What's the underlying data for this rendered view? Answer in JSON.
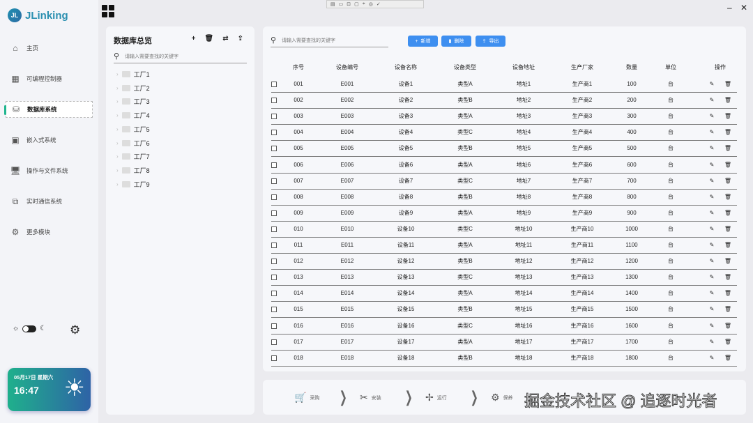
{
  "app": {
    "logo_badge": "JL",
    "title": "JLinking"
  },
  "sidebar": {
    "items": [
      {
        "label": "主页",
        "icon": "home-icon",
        "glyph": "⌂"
      },
      {
        "label": "可编程控制器",
        "icon": "chip-icon",
        "glyph": "▦"
      },
      {
        "label": "数据库系统",
        "icon": "database-icon",
        "glyph": "⛁",
        "active": true
      },
      {
        "label": "嵌入式系统",
        "icon": "cpu-icon",
        "glyph": "▣"
      },
      {
        "label": "操作与文件系统",
        "icon": "os-monitor-icon",
        "glyph": "🖥"
      },
      {
        "label": "实时通信系统",
        "icon": "communication-icon",
        "glyph": "⧉"
      },
      {
        "label": "更多模块",
        "icon": "gear-icon",
        "glyph": "⚙"
      }
    ]
  },
  "weather": {
    "date": "05月17日  星期六",
    "time": "16:47"
  },
  "tree": {
    "title": "数据库总览",
    "search_placeholder": "请输入需要查找的关键字",
    "items": [
      "工厂1",
      "工厂2",
      "工厂3",
      "工厂4",
      "工厂5",
      "工厂6",
      "工厂7",
      "工厂8",
      "工厂9"
    ]
  },
  "table": {
    "search_placeholder": "请输入需要查找的关键字",
    "buttons": {
      "add": "新增",
      "delete": "删除",
      "export": "导出"
    },
    "headers": [
      "序号",
      "设备编号",
      "设备名称",
      "设备类型",
      "设备地址",
      "生产厂家",
      "数量",
      "单位",
      "操作"
    ],
    "types": [
      "A",
      "B",
      "A",
      "C",
      "B",
      "A",
      "C",
      "B",
      "A",
      "C",
      "A",
      "B",
      "C",
      "A",
      "B",
      "C",
      "A",
      "B"
    ],
    "unit": "台",
    "row_count": 18
  },
  "process": {
    "steps": [
      "采购",
      "安装",
      "运行",
      "保养"
    ]
  },
  "watermark": "掘金技术社区 @ 追逐时光者"
}
